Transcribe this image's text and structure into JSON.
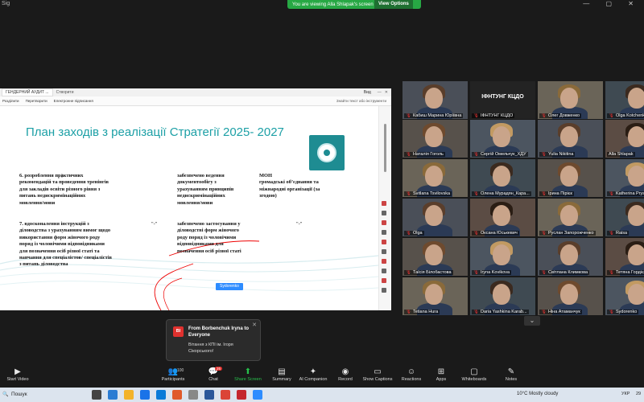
{
  "topbar": {
    "left_label": "Sig",
    "banner_text": "You are viewing Alla Shlapak's screen",
    "view_options": "View Options"
  },
  "document": {
    "tab1": "ГЕНДЕРНИЙ АУДИТ ...",
    "tab2": "Створити",
    "mode": "Вид",
    "toolbar": {
      "item1": "Розділити",
      "item2": "Перетворити",
      "item3": "Електронне підписання",
      "search": "Знайти текст або інструменти"
    },
    "title": "План заходів з реалізації Стратегії 2025- 2027",
    "col1_row1": [
      "6. розроблення практичних",
      "рекомендацій та проведення тренінгів",
      "для закладів освіти різного рівня з",
      "питань недискримінаційних",
      "мовлення/мови"
    ],
    "col2_row1": [
      "забезпечено ведення",
      "документообігу з",
      "урахуванням принципів",
      "недискримінаційних",
      "мовлення/мови"
    ],
    "col3_row1": [
      "МОН",
      " громадські об’єднання та",
      "міжнародні організації (за",
      "згодою)"
    ],
    "col1_row2": [
      "7. вдосконалення інструкцій з",
      "діловодства з урахуванням вимог щодо",
      "використання форм жіночого роду",
      "поряд із чоловічими відповідниками",
      "для позначення осіб різної статі та",
      "навчання для спеціалістов/ спеціалістів",
      "з питань діловодства"
    ],
    "col_mark_left": "\"-\"",
    "col2_row2": [
      "забезпечено застосування у",
      "діловодстві форм жіночого",
      "роду поряд із чоловічими",
      "відповідниками для",
      "позначення осіб різної статі"
    ],
    "col_mark_right": "\"-\"",
    "speaker_tag": "Sydorenko"
  },
  "participants": [
    {
      "name": "Кабиш Марина Юріївна",
      "muted": true,
      "type": "video"
    },
    {
      "name": "ІФНТУНГ КЦДО",
      "muted": true,
      "type": "text",
      "big": "ІФНТУНГ КЦДО"
    },
    {
      "name": "Олег Довженко",
      "muted": true,
      "type": "video"
    },
    {
      "name": "Olga Kotchenko",
      "muted": true,
      "type": "video"
    },
    {
      "name": "Наталія Гоголь",
      "muted": true,
      "type": "video"
    },
    {
      "name": "Сергій Омельчук_ХДУ",
      "muted": true,
      "type": "video"
    },
    {
      "name": "Yulia Nikitina",
      "muted": true,
      "type": "video"
    },
    {
      "name": "Alla Shlapak",
      "muted": false,
      "type": "video"
    },
    {
      "name": "Svitlana Tsvilovska",
      "muted": true,
      "type": "video"
    },
    {
      "name": "Олена Мурадян_Кара...",
      "muted": true,
      "type": "video"
    },
    {
      "name": "Ірина Пірієк",
      "muted": true,
      "type": "video"
    },
    {
      "name": "Katherina Prysiazhniuk",
      "muted": true,
      "type": "video"
    },
    {
      "name": "Olga",
      "muted": true,
      "type": "video"
    },
    {
      "name": "Оксана Юськевич",
      "muted": true,
      "type": "video"
    },
    {
      "name": "Руслан Запорожченко",
      "muted": true,
      "type": "video"
    },
    {
      "name": "Raisa",
      "muted": true,
      "type": "video"
    },
    {
      "name": "Таїсія Білобастова",
      "muted": true,
      "type": "video"
    },
    {
      "name": "Iryna Kovikova",
      "muted": true,
      "type": "video"
    },
    {
      "name": "Світлана Климкова",
      "muted": true,
      "type": "video"
    },
    {
      "name": "Тетяна Гордієнко",
      "muted": true,
      "type": "video"
    },
    {
      "name": "Tetiana Hura",
      "muted": true,
      "type": "video"
    },
    {
      "name": "Daria Yashkina Karab...",
      "muted": true,
      "type": "video"
    },
    {
      "name": "Ніна Атаманчук",
      "muted": true,
      "type": "video"
    },
    {
      "name": "Sydorenko",
      "muted": true,
      "type": "video"
    }
  ],
  "chat": {
    "avatar": "BI",
    "from": "From Borbenchuk Iryna to Everyone",
    "message": "Вітання з КПІ ім. Ігоря Сікорського!"
  },
  "toolbar": {
    "start_video": "Start Video",
    "participants": "Participants",
    "participants_count": "100",
    "chat": "Chat",
    "chat_badge": "26",
    "share_screen": "Share Screen",
    "summary": "Summary",
    "ai_companion": "AI Companion",
    "record": "Record",
    "show_captions": "Show Captions",
    "reactions": "Reactions",
    "apps": "Apps",
    "whiteboards": "Whiteboards",
    "notes": "Notes"
  },
  "taskbar": {
    "search": "Пошук",
    "weather": "10°C  Mostly cloudy",
    "lang": "УКР",
    "clock": "29"
  },
  "colors": {
    "title_teal": "#1da0a6",
    "zoom_green": "#27a844",
    "share_green": "#27c24c",
    "badge_red": "#e0312e"
  }
}
